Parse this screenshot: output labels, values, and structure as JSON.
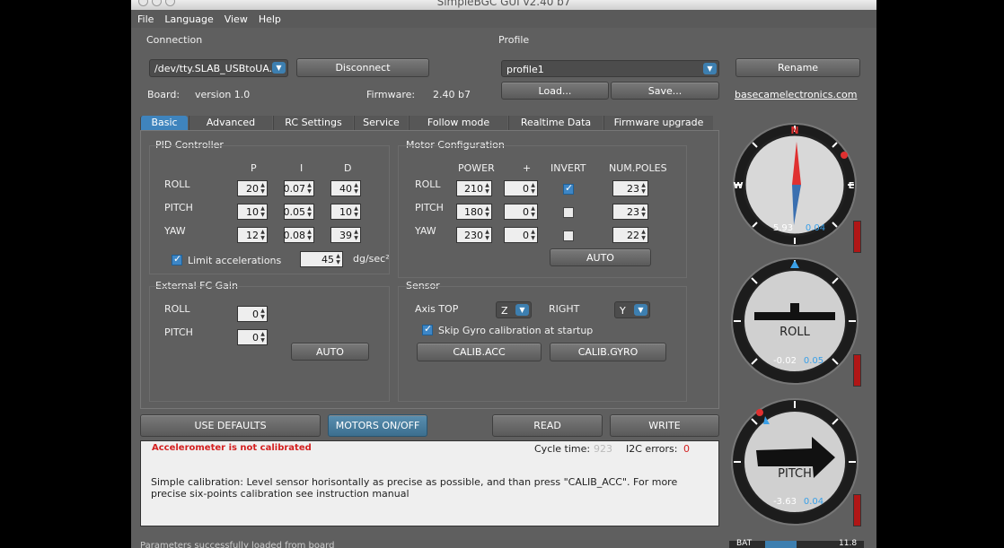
{
  "window": {
    "title": "SimpleBGC GUI v2.40 b7"
  },
  "menu": [
    "File",
    "Language",
    "View",
    "Help"
  ],
  "connection": {
    "section": "Connection",
    "port": "/dev/tty.SLAB_USBtoUA...",
    "disconnect": "Disconnect",
    "board_label": "Board:",
    "board_value": "version 1.0",
    "firmware_label": "Firmware:",
    "firmware_value": "2.40 b7"
  },
  "profile": {
    "section": "Profile",
    "name": "profile1",
    "load": "Load...",
    "save": "Save...",
    "rename": "Rename",
    "website": "basecamelectronics.com"
  },
  "tabs": [
    "Basic",
    "Advanced",
    "RC Settings",
    "Service",
    "Follow mode",
    "Realtime Data",
    "Firmware upgrade"
  ],
  "pid": {
    "section": "PID Controller",
    "headers": [
      "P",
      "I",
      "D"
    ],
    "rows": [
      {
        "label": "ROLL",
        "p": "20",
        "i": "0.07",
        "d": "40"
      },
      {
        "label": "PITCH",
        "p": "10",
        "i": "0.05",
        "d": "10"
      },
      {
        "label": "YAW",
        "p": "12",
        "i": "0.08",
        "d": "39"
      }
    ],
    "limit_label": "Limit accelerations",
    "limit_checked": true,
    "limit_value": "45",
    "limit_unit": "dg/sec²"
  },
  "motor": {
    "section": "Motor Configuration",
    "headers": [
      "POWER",
      "+",
      "INVERT",
      "NUM.POLES"
    ],
    "rows": [
      {
        "label": "ROLL",
        "power": "210",
        "plus": "0",
        "invert": true,
        "poles": "23"
      },
      {
        "label": "PITCH",
        "power": "180",
        "plus": "0",
        "invert": false,
        "poles": "23"
      },
      {
        "label": "YAW",
        "power": "230",
        "plus": "0",
        "invert": false,
        "poles": "22"
      }
    ],
    "auto": "AUTO"
  },
  "external_fc": {
    "section": "External FC Gain",
    "rows": [
      {
        "label": "ROLL",
        "value": "0"
      },
      {
        "label": "PITCH",
        "value": "0"
      }
    ],
    "auto": "AUTO"
  },
  "sensor": {
    "section": "Sensor",
    "axis_top_label": "Axis TOP",
    "axis_top_value": "Z",
    "right_label": "RIGHT",
    "right_value": "Y",
    "skip_gyro_label": "Skip Gyro calibration at startup",
    "skip_gyro_checked": true,
    "calib_acc": "CALIB.ACC",
    "calib_gyro": "CALIB.GYRO"
  },
  "actions": {
    "use_defaults": "USE DEFAULTS",
    "motors": "MOTORS ON/OFF",
    "read": "READ",
    "write": "WRITE"
  },
  "status": {
    "warning": "Accelerometer is not calibrated",
    "cycle_label": "Cycle time:",
    "cycle_value": "923",
    "i2c_label": "I2C errors:",
    "i2c_value": "0",
    "message": "Simple calibration: Level sensor horisontally as precise as possible, and than press \"CALIB_ACC\". For more precise six-points calibration see instruction manual"
  },
  "bottom_text": "Parameters successfully loaded from board",
  "gauges": {
    "yaw": {
      "n": "N",
      "e": "E",
      "w": "W",
      "value": "5.93",
      "rate": "0.04"
    },
    "roll": {
      "label": "ROLL",
      "value": "-0.02",
      "rate": "0.05"
    },
    "pitch": {
      "label": "PITCH",
      "value": "-3.63",
      "rate": "0.04"
    }
  },
  "battery": {
    "label": "BAT",
    "value": "11.8"
  },
  "colors": {
    "accent": "#3f84bd",
    "warning": "#d42020",
    "gauge_value_blue": "#3aa0e8"
  }
}
